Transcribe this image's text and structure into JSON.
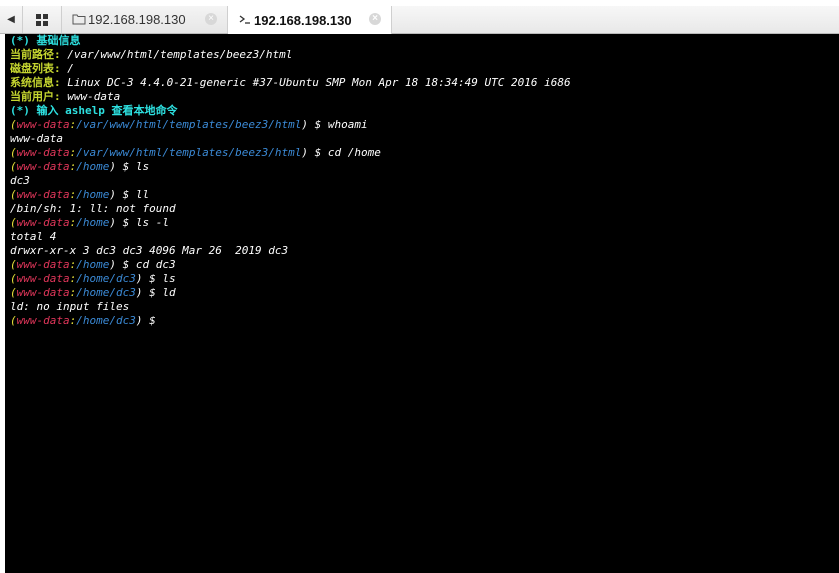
{
  "tabs": [
    {
      "label": "192.168.198.130",
      "icon": "folder-icon",
      "active": false
    },
    {
      "label": "192.168.198.130",
      "icon": "terminal-icon",
      "active": true
    }
  ],
  "terminal": {
    "header": {
      "basic_info": "(*) 基础信息",
      "cwd_label": "当前路径:",
      "cwd_value": " /var/www/html/templates/beez3/html",
      "disks_label": "磁盘列表:",
      "disks_value": " /",
      "system_label": "系统信息:",
      "system_value": " Linux DC-3 4.4.0-21-generic #37-Ubuntu SMP Mon Apr 18 18:34:49 UTC 2016 i686",
      "user_label": "当前用户:",
      "user_value": " www-data",
      "help_hint": "(*) 输入 ashelp 查看本地命令"
    },
    "lines": [
      {
        "type": "prompt",
        "user": "www-data",
        "path": "/var/www/html/templates/beez3/html",
        "cmd": " whoami"
      },
      {
        "type": "out",
        "text": "www-data"
      },
      {
        "type": "prompt",
        "user": "www-data",
        "path": "/var/www/html/templates/beez3/html",
        "cmd": " cd /home"
      },
      {
        "type": "prompt",
        "user": "www-data",
        "path": "/home",
        "cmd": " ls"
      },
      {
        "type": "out",
        "text": "dc3"
      },
      {
        "type": "prompt",
        "user": "www-data",
        "path": "/home",
        "cmd": " ll"
      },
      {
        "type": "out",
        "text": "/bin/sh: 1: ll: not found"
      },
      {
        "type": "prompt",
        "user": "www-data",
        "path": "/home",
        "cmd": " ls -l"
      },
      {
        "type": "out",
        "text": "total 4"
      },
      {
        "type": "out",
        "text": "drwxr-xr-x 3 dc3 dc3 4096 Mar 26  2019 dc3"
      },
      {
        "type": "prompt",
        "user": "www-data",
        "path": "/home",
        "cmd": " cd dc3"
      },
      {
        "type": "prompt",
        "user": "www-data",
        "path": "/home/dc3",
        "cmd": " ls"
      },
      {
        "type": "prompt",
        "user": "www-data",
        "path": "/home/dc3",
        "cmd": " ld"
      },
      {
        "type": "out",
        "text": "ld: no input files"
      },
      {
        "type": "prompt",
        "user": "www-data",
        "path": "/home/dc3",
        "cmd": ""
      }
    ],
    "prompt_open": "(",
    "prompt_colon": ":",
    "prompt_close": ") $",
    "colors": {
      "background": "#000000",
      "label": "#c6d630",
      "header": "#2de0e0",
      "user": "#e0365a",
      "path": "#3b8ad6",
      "prompt": "#e8e23a",
      "output": "#ffffff"
    }
  }
}
